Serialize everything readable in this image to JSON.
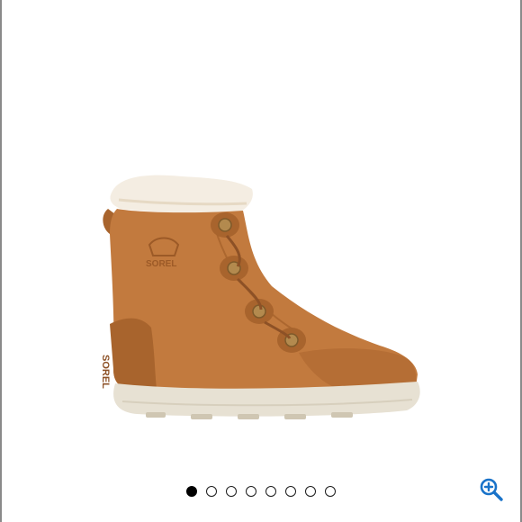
{
  "product_image": {
    "icon": "sorel-explorer-boot",
    "brand_mark": "SOREL",
    "colors": {
      "suede": "#c27a3e",
      "suede_shadow": "#9c5a27",
      "fur": "#f4ede2",
      "sole": "#e7e1d3",
      "eyelet": "#b38a4e"
    }
  },
  "carousel": {
    "slide_count": 8,
    "active_index": 0
  },
  "zoom": {
    "icon": "zoom-in-icon",
    "color": "#1a73c9"
  }
}
